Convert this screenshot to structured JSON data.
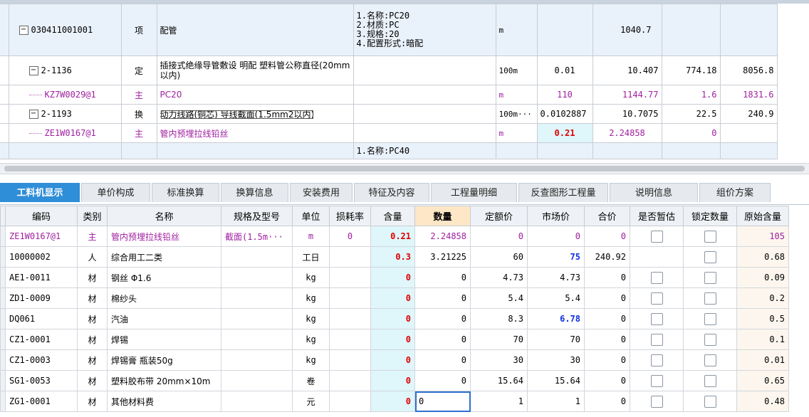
{
  "top_rows": [
    {
      "code": "030411001001",
      "tree": "minus",
      "type": "项",
      "name": "配管",
      "desc": [
        "1.名称:PC20",
        "2.材质:PC",
        "3.规格:20",
        "4.配置形式:暗配"
      ],
      "unit": "m",
      "content": "",
      "qty": "1040.7",
      "price": "",
      "total": ""
    },
    {
      "code": "2-1136",
      "tree": "minus",
      "type": "定",
      "name": "插接式绝缘导管敷设 明配 塑料管公称直径(20mm以内)",
      "desc": [],
      "unit": "100m",
      "content": "0.01",
      "qty": "10.407",
      "price": "774.18",
      "total": "8056.8"
    },
    {
      "code": "KZ7W0029@1",
      "tree": "leaf",
      "type": "主",
      "name": "PC20",
      "desc": [],
      "unit": "m",
      "content": "110",
      "qty": "1144.77",
      "price": "1.6",
      "total": "1831.6"
    },
    {
      "code": "2-1193",
      "tree": "minus",
      "type": "换",
      "name": "动力线路(铜芯) 导线截面(1.5mm2以内)",
      "desc": [],
      "unit": "100m···",
      "content": "0.0102887",
      "qty": "10.7075",
      "price": "22.5",
      "total": "240.9"
    },
    {
      "code": "ZE1W0167@1",
      "tree": "leaf",
      "type": "主",
      "name": "管内预埋拉线铅丝",
      "desc": [],
      "unit": "m",
      "content": "0.21",
      "qty": "2.24858",
      "price": "0",
      "total": ""
    },
    {
      "code": "",
      "tree": "",
      "type": "",
      "name": "",
      "desc": [
        "1.名称:PC40"
      ],
      "unit": "",
      "content": "",
      "qty": "",
      "price": "",
      "total": ""
    }
  ],
  "tabs": [
    "工料机显示",
    "单价构成",
    "标准换算",
    "换算信息",
    "安装费用",
    "特征及内容",
    "工程量明细",
    "反查图形工程量",
    "说明信息",
    "组价方案"
  ],
  "columns": [
    "编码",
    "类别",
    "名称",
    "规格及型号",
    "单位",
    "损耗率",
    "含量",
    "数量",
    "定额价",
    "市场价",
    "合价",
    "是否暂估",
    "锁定数量",
    "原始含量"
  ],
  "rows": [
    {
      "code": "ZE1W0167@1",
      "cat": "主",
      "name": "管内预埋拉线铅丝",
      "spec": "截面(1.5m···",
      "unit": "m",
      "loss": "0",
      "content": "0.21",
      "qty": "2.24858",
      "base": "0",
      "market": "0",
      "total": "0",
      "orig": "105"
    },
    {
      "code": "10000002",
      "cat": "人",
      "name": "综合用工二类",
      "spec": "",
      "unit": "工日",
      "loss": "",
      "content": "0.3",
      "qty": "3.21225",
      "base": "60",
      "market": "75",
      "total": "240.92",
      "orig": "0.68"
    },
    {
      "code": "AE1-0011",
      "cat": "材",
      "name": "钢丝 Φ1.6",
      "spec": "",
      "unit": "kg",
      "loss": "",
      "content": "0",
      "qty": "0",
      "base": "4.73",
      "market": "4.73",
      "total": "0",
      "orig": "0.09"
    },
    {
      "code": "ZD1-0009",
      "cat": "材",
      "name": "棉纱头",
      "spec": "",
      "unit": "kg",
      "loss": "",
      "content": "0",
      "qty": "0",
      "base": "5.4",
      "market": "5.4",
      "total": "0",
      "orig": "0.2"
    },
    {
      "code": "DQ061",
      "cat": "材",
      "name": "汽油",
      "spec": "",
      "unit": "kg",
      "loss": "",
      "content": "0",
      "qty": "0",
      "base": "8.3",
      "market": "6.78",
      "total": "0",
      "orig": "0.5"
    },
    {
      "code": "CZ1-0001",
      "cat": "材",
      "name": "焊锡",
      "spec": "",
      "unit": "kg",
      "loss": "",
      "content": "0",
      "qty": "0",
      "base": "70",
      "market": "70",
      "total": "0",
      "orig": "0.1"
    },
    {
      "code": "CZ1-0003",
      "cat": "材",
      "name": "焊锡膏 瓶装50g",
      "spec": "",
      "unit": "kg",
      "loss": "",
      "content": "0",
      "qty": "0",
      "base": "30",
      "market": "30",
      "total": "0",
      "orig": "0.01"
    },
    {
      "code": "SG1-0053",
      "cat": "材",
      "name": "塑料胶布带 20mm×10m",
      "spec": "",
      "unit": "卷",
      "loss": "",
      "content": "0",
      "qty": "0",
      "base": "15.64",
      "market": "15.64",
      "total": "0",
      "orig": "0.65"
    },
    {
      "code": "ZG1-0001",
      "cat": "材",
      "name": "其他材料费",
      "spec": "",
      "unit": "元",
      "loss": "",
      "content": "0",
      "qty": "0",
      "base": "1",
      "market": "1",
      "total": "0",
      "orig": "0.48"
    }
  ],
  "colors": {
    "tab_active": "#2f8ed8",
    "purple": "#a020a0",
    "red": "#e00000",
    "blue": "#1030e0",
    "qty_bg": "#dff6fa",
    "header_highlight": "#fde7c7"
  }
}
